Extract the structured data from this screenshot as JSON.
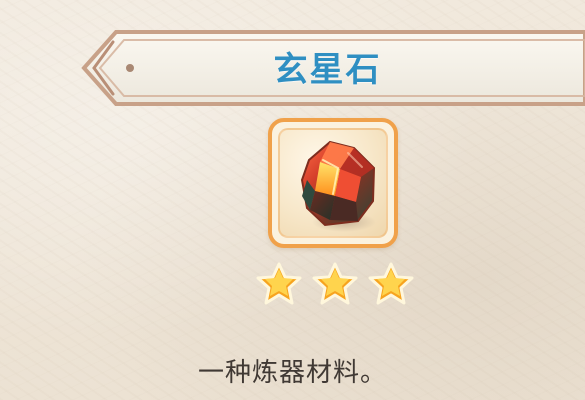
{
  "item": {
    "name": "玄星石",
    "description": "一种炼器材料。",
    "stars": 3,
    "icon": "red-crystal-ore-icon"
  },
  "colors": {
    "title": "#2f8fc2",
    "frame": "#f0a14a",
    "star": "#f7a41f",
    "text": "#403934"
  }
}
